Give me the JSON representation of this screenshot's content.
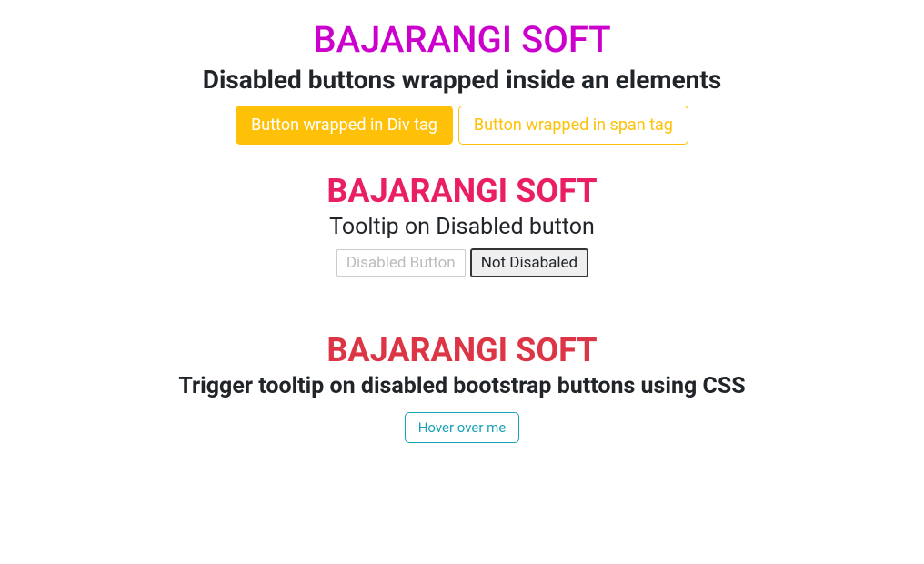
{
  "section1": {
    "brand": "BAJARANGI SOFT",
    "subtitle": "Disabled buttons wrapped inside an elements",
    "btn_div": "Button wrapped in Div tag",
    "btn_span": "Button wrapped in span tag"
  },
  "section2": {
    "brand": "BAJARANGI SOFT",
    "subtitle": "Tooltip on Disabled button",
    "btn_disabled": "Disabled Button",
    "btn_not_disabled": "Not Disabaled"
  },
  "section3": {
    "brand": "BAJARANGI SOFT",
    "subtitle": "Trigger tooltip on disabled bootstrap buttons using CSS",
    "btn_hover": "Hover over me"
  }
}
